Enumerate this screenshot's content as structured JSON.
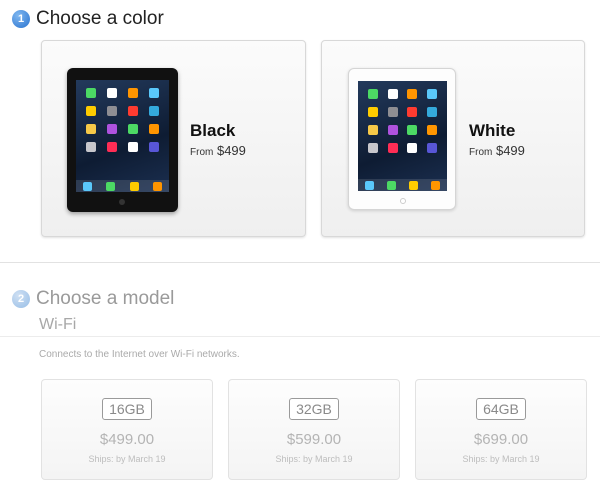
{
  "step1": {
    "number": "1",
    "title": "Choose a color"
  },
  "colors": [
    {
      "name": "Black",
      "from_label": "From",
      "price": "$499"
    },
    {
      "name": "White",
      "from_label": "From",
      "price": "$499"
    }
  ],
  "step2": {
    "number": "2",
    "title": "Choose a model"
  },
  "wifi": {
    "title": "Wi-Fi",
    "description": "Connects to the Internet over Wi-Fi networks."
  },
  "models": [
    {
      "capacity": "16GB",
      "price": "$499.00",
      "ships": "Ships: by March 19"
    },
    {
      "capacity": "32GB",
      "price": "$599.00",
      "ships": "Ships: by March 19"
    },
    {
      "capacity": "64GB",
      "price": "$699.00",
      "ships": "Ships: by March 19"
    }
  ],
  "colors_theme": {
    "accent": "#2a73cf",
    "muted": "#9a9a9a"
  }
}
